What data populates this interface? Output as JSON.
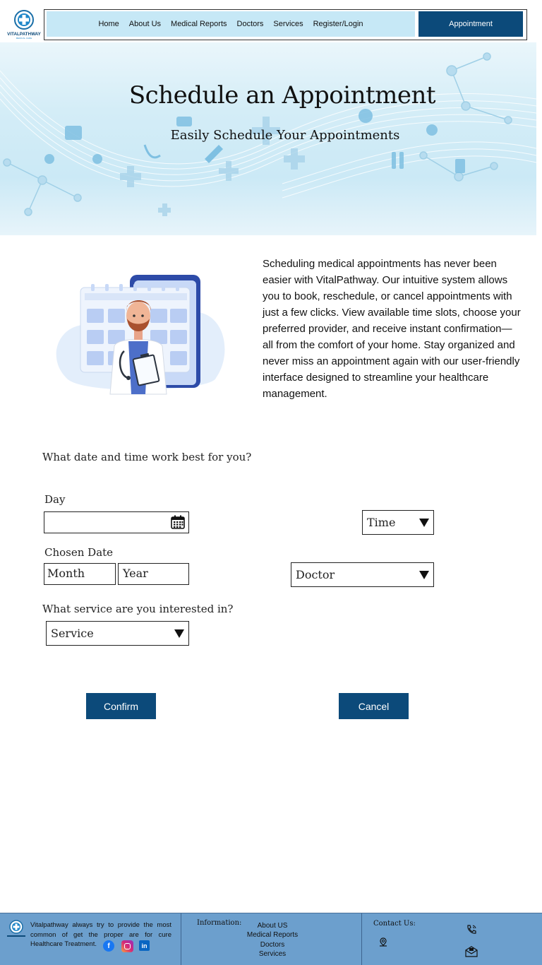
{
  "header": {
    "logo_text": "VITALPATHWAY",
    "nav": [
      "Home",
      "About Us",
      "Medical Reports",
      "Doctors",
      "Services",
      "Register/Login"
    ],
    "appointment_label": "Appointment"
  },
  "hero": {
    "title": "Schedule an Appointment",
    "subtitle": "Easily Schedule Your Appointments"
  },
  "intro": {
    "text": "Scheduling medical appointments has never been easier with VitalPathway. Our intuitive system allows you to book, reschedule, or cancel appointments with just a few clicks. View available time slots, choose your preferred provider, and receive instant confirmation—all from the comfort of your home. Stay organized and never miss an appointment again with our user-friendly interface designed to streamline your healthcare management."
  },
  "form": {
    "question_datetime": "What date and time work best for you?",
    "day_label": "Day",
    "time_label": "Time",
    "chosen_date_label": "Chosen Date",
    "month_placeholder": "Month",
    "year_placeholder": "Year",
    "doctor_label": "Doctor",
    "question_service": "What service are you interested in?",
    "service_label": "Service",
    "confirm_label": "Confirm",
    "cancel_label": "Cancel"
  },
  "footer": {
    "about": "Vitalpathway always try to provide the most common of get the proper are for cure Healthcare Treatment.",
    "info_heading": "Information:",
    "links": [
      "About US",
      "Medical Reports",
      "Doctors",
      "Services"
    ],
    "contact_heading": "Contact Us:"
  },
  "colors": {
    "brand_dark": "#0c4a7a",
    "nav_bg": "#c6e8f6",
    "footer_bg": "#6c9fcd"
  }
}
